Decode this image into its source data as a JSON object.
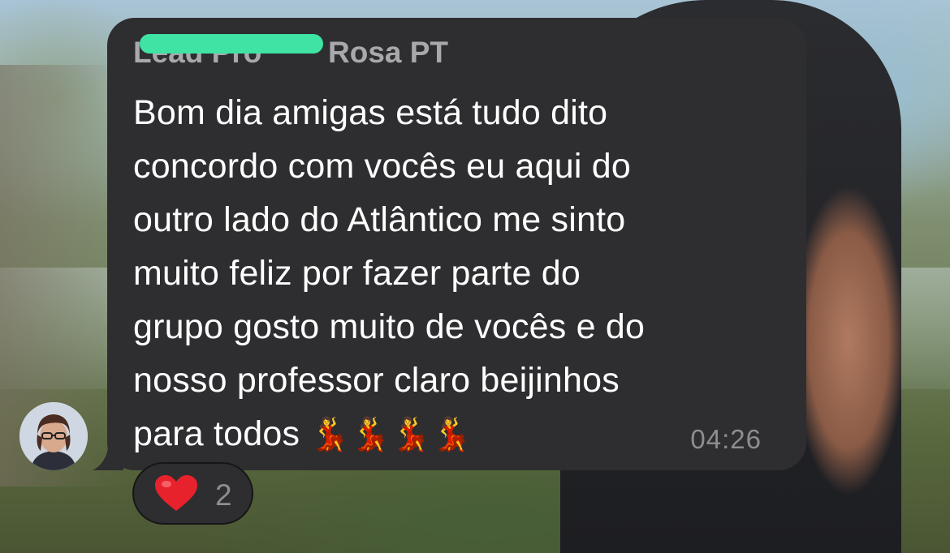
{
  "message": {
    "sender_visible": "Rosa PT",
    "sender_obscured_prefix": "Lead Pro",
    "lines": [
      "Bom dia amigas está tudo dito",
      "concordo com vocês eu aqui do",
      "outro lado do Atlântico me sinto",
      "muito feliz por fazer parte do",
      "grupo gosto muito de vocês e do",
      "nosso professor claro beijinhos",
      "para todos"
    ],
    "trailing_emoji": "💃💃💃💃",
    "time": "04:26"
  },
  "reaction": {
    "emoji": "heart",
    "count": "2"
  },
  "colors": {
    "bubble": "#2e2e30",
    "text": "#ffffff",
    "secondary_text": "#a9a9ad",
    "redaction": "#3fe3a4",
    "heart": "#e8222c"
  }
}
